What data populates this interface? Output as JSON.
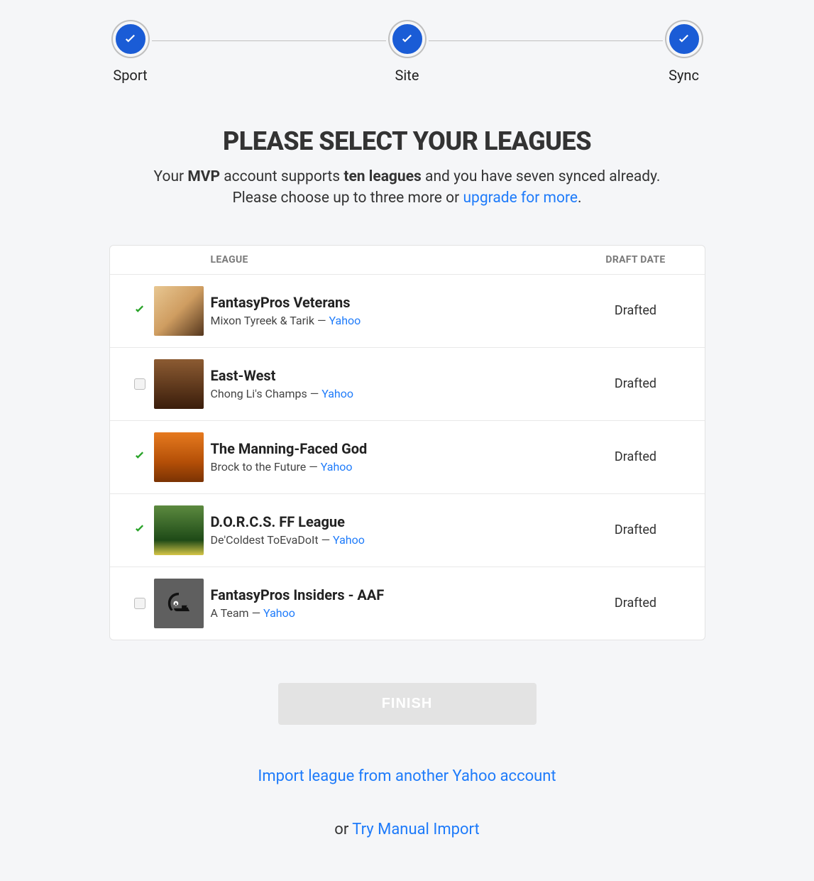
{
  "stepper": {
    "steps": [
      "Sport",
      "Site",
      "Sync"
    ]
  },
  "heading": "PLEASE SELECT YOUR LEAGUES",
  "subhead": {
    "pre": "Your ",
    "tier": "MVP",
    "mid1": " account supports ",
    "limit": "ten leagues",
    "mid2": " and you have seven synced already.",
    "line2_pre": "Please choose up to three more or ",
    "upgrade": "upgrade for more",
    "line2_post": "."
  },
  "table": {
    "header_league": "LEAGUE",
    "header_draft": "DRAFT DATE",
    "rows": [
      {
        "selected": true,
        "avatar": "av0",
        "name": "FantasyPros Veterans",
        "team": "Mixon Tyreek & Tarik",
        "sep": " — ",
        "site": "Yahoo",
        "draft": "Drafted"
      },
      {
        "selected": false,
        "avatar": "av1",
        "name": "East-West",
        "team": "Chong Li's Champs",
        "sep": " — ",
        "site": "Yahoo",
        "draft": "Drafted"
      },
      {
        "selected": true,
        "avatar": "av2",
        "name": "The Manning-Faced God",
        "team": "Brock to the Future",
        "sep": " — ",
        "site": "Yahoo",
        "draft": "Drafted"
      },
      {
        "selected": true,
        "avatar": "av3",
        "name": "D.O.R.C.S. FF League",
        "team": "De'Coldest ToEvaDoIt",
        "sep": " — ",
        "site": "Yahoo",
        "draft": "Drafted"
      },
      {
        "selected": false,
        "avatar": "av4",
        "name": "FantasyPros Insiders - AAF",
        "team": "A Team",
        "sep": " — ",
        "site": "Yahoo",
        "draft": "Drafted"
      }
    ]
  },
  "footer": {
    "finish": "FINISH",
    "import_another": "Import league from another Yahoo account",
    "or": "or ",
    "manual": "Try Manual Import"
  }
}
